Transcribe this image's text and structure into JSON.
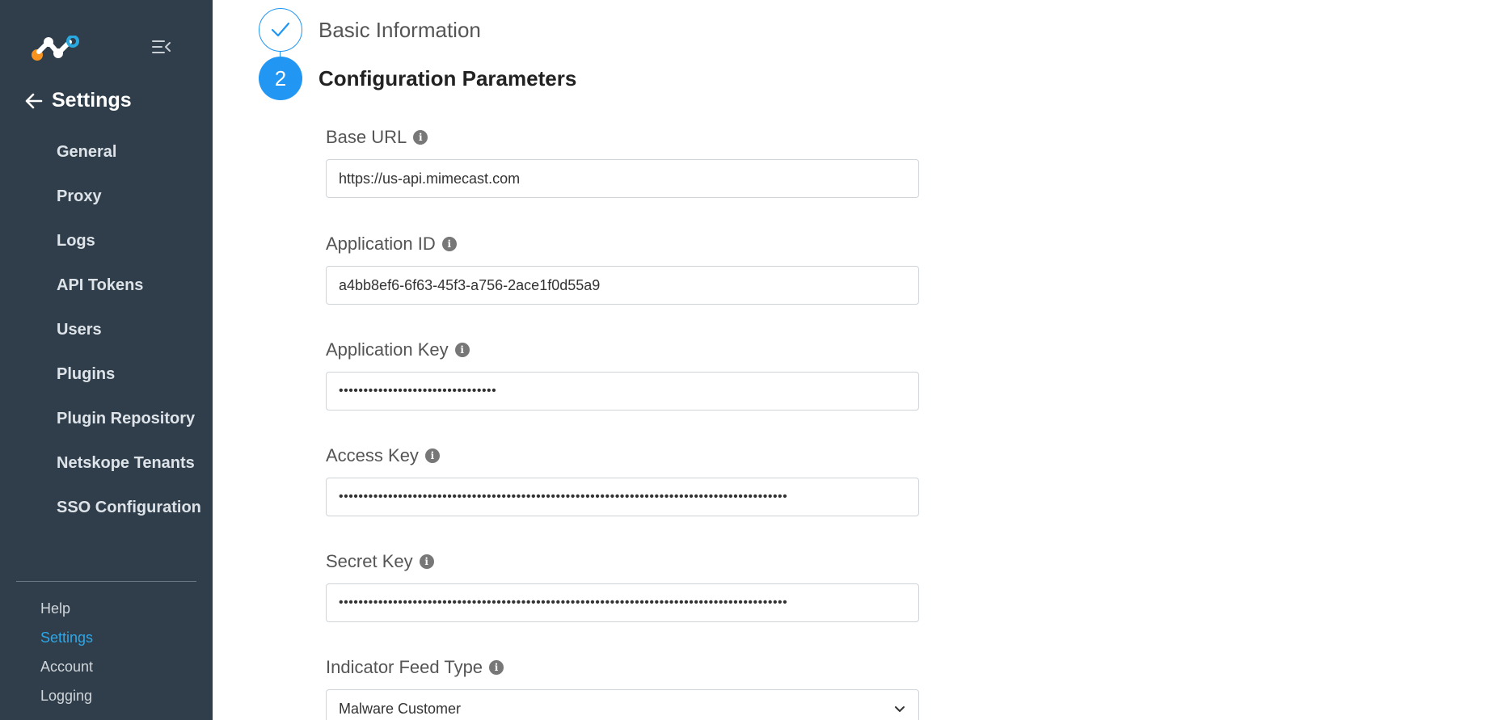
{
  "sidebar": {
    "logo": "netskope-logo",
    "collapse_icon": "collapse-menu-icon",
    "header": {
      "back_icon": "arrow-left-icon",
      "title": "Settings"
    },
    "items": [
      {
        "label": "General"
      },
      {
        "label": "Proxy"
      },
      {
        "label": "Logs"
      },
      {
        "label": "API Tokens"
      },
      {
        "label": "Users"
      },
      {
        "label": "Plugins"
      },
      {
        "label": "Plugin Repository"
      },
      {
        "label": "Netskope Tenants"
      },
      {
        "label": "SSO Configuration"
      }
    ],
    "footer": [
      {
        "label": "Help"
      },
      {
        "label": "Settings",
        "active": true
      },
      {
        "label": "Account"
      },
      {
        "label": "Logging"
      }
    ]
  },
  "steps": [
    {
      "state": "done",
      "icon": "checkmark-icon",
      "label": "Basic Information"
    },
    {
      "state": "current",
      "number": "2",
      "label": "Configuration Parameters"
    }
  ],
  "form": {
    "base_url": {
      "label": "Base URL",
      "value": "https://us-api.mimecast.com"
    },
    "application_id": {
      "label": "Application ID",
      "value": "a4bb8ef6-6f63-45f3-a756-2ace1f0d55a9"
    },
    "application_key": {
      "label": "Application Key",
      "value": "••••••••••••••••••••••••••••••••"
    },
    "access_key": {
      "label": "Access Key",
      "value": "•••••••••••••••••••••••••••••••••••••••••••••••••••••••••••••••••••••••••••••••••••••••••••"
    },
    "secret_key": {
      "label": "Secret Key",
      "value": "•••••••••••••••••••••••••••••••••••••••••••••••••••••••••••••••••••••••••••••••••••••••••••"
    },
    "indicator_feed_type": {
      "label": "Indicator Feed Type",
      "value": "Malware Customer"
    }
  },
  "colors": {
    "sidebar_bg": "#2f3e4a",
    "accent": "#2196f3",
    "active_link": "#2ea7e8"
  }
}
